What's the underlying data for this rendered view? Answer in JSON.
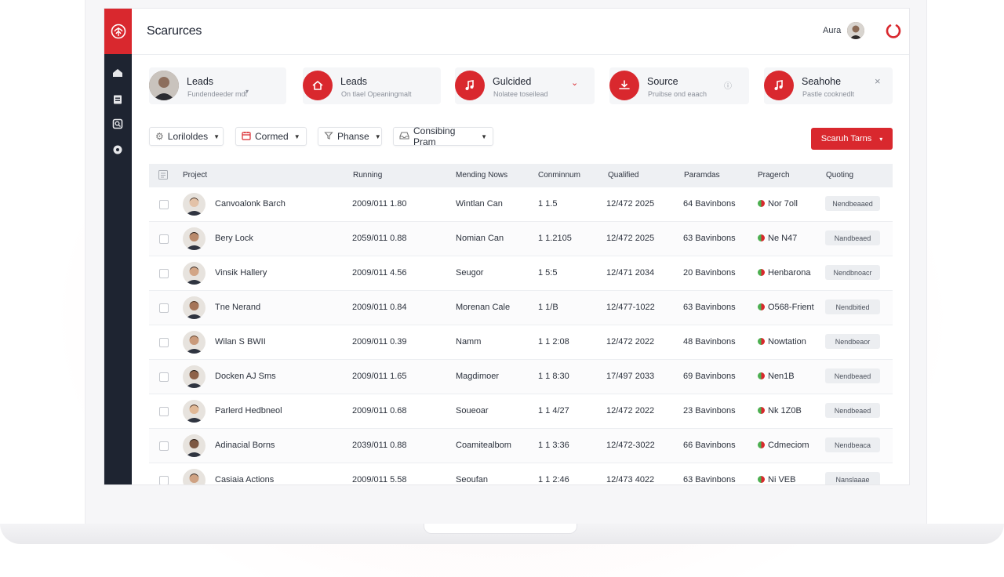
{
  "app": {
    "title": "Scarurces"
  },
  "user": {
    "name": "Aura"
  },
  "cards": [
    {
      "title": "Leads",
      "subtitle": "Fundendeeder mdt",
      "icon": "user-avatar"
    },
    {
      "title": "Leads",
      "subtitle": "On tlael Opeaningmalt",
      "icon": "home-icon"
    },
    {
      "title": "Gulcided",
      "subtitle": "Nolatee toseilead",
      "icon": "music-note-icon"
    },
    {
      "title": "Source",
      "subtitle": "Pruibse ond eaach",
      "icon": "download-icon"
    },
    {
      "title": "Seahohe",
      "subtitle": "Pastle cooknedlt",
      "icon": "music-note-icon"
    }
  ],
  "filters": [
    {
      "label": "Loriloldes",
      "icon": "settings-icon"
    },
    {
      "label": "Cormed",
      "icon": "calendar-icon"
    },
    {
      "label": "Phanse",
      "icon": "filter-icon"
    },
    {
      "label": "Consibing Pram",
      "icon": "inbox-icon"
    }
  ],
  "search_button": {
    "label": "Scaruh Tarns"
  },
  "table": {
    "headers": [
      "Project",
      "Running",
      "Mending Nows",
      "Conminnum",
      "Qualified",
      "Paramdas",
      "Pragerch",
      "Quoting"
    ],
    "rows": [
      {
        "name": "Canvoalonk Barch",
        "running": "2009/011 1.80",
        "mending": "Wintlan Can",
        "conminnum": "1 1.5",
        "qualified": "12/472 2025",
        "paramdas": "64 Bavinbons",
        "pragerch": "Nor 7oll",
        "quoting": "Nendbeaaed"
      },
      {
        "name": "Bery Lock",
        "running": "2059/011 0.88",
        "mending": "Nomian Can",
        "conminnum": "1 1.2105",
        "qualified": "12/472 2025",
        "paramdas": "63 Bavinbons",
        "pragerch": "Ne N47",
        "quoting": "Nandbeaed"
      },
      {
        "name": "Vinsik Hallery",
        "running": "2009/011 4.56",
        "mending": "Seugor",
        "conminnum": "1 5:5",
        "qualified": "12/471 2034",
        "paramdas": "20 Bavinbons",
        "pragerch": "Henbarona",
        "quoting": "Nendbnoacr"
      },
      {
        "name": "Tne Nerand",
        "running": "2009/011 0.84",
        "mending": "Morenan Cale",
        "conminnum": "1 1/B",
        "qualified": "12/477-1022",
        "paramdas": "63 Bavinbons",
        "pragerch": "O568-Frient",
        "quoting": "Nendbitied"
      },
      {
        "name": "Wilan S BWII",
        "running": "2009/011 0.39",
        "mending": "Namm",
        "conminnum": "1 1 2:08",
        "qualified": "12/472 2022",
        "paramdas": "48 Bavinbons",
        "pragerch": "Nowtation",
        "quoting": "Nendbeaor"
      },
      {
        "name": "Docken AJ Sms",
        "running": "2009/011 1.65",
        "mending": "Magdimoer",
        "conminnum": "1 1 8:30",
        "qualified": "17/497 2033",
        "paramdas": "69 Bavinbons",
        "pragerch": "Nen1B",
        "quoting": "Nendbeaed"
      },
      {
        "name": "Parlerd Hedbneol",
        "running": "2009/011 0.68",
        "mending": "Soueoar",
        "conminnum": "1 1 4/27",
        "qualified": "12/472 2022",
        "paramdas": "23 Bavinbons",
        "pragerch": "Nk 1Z0B",
        "quoting": "Nendbeaed"
      },
      {
        "name": "Adinacial Borns",
        "running": "2039/011 0.88",
        "mending": "Coamitealbom",
        "conminnum": "1 1 3:36",
        "qualified": "12/472-3022",
        "paramdas": "66 Bavinbons",
        "pragerch": "Cdmeciom",
        "quoting": "Nendbeaca"
      },
      {
        "name": "Casiaia Actions",
        "running": "2009/011 5.58",
        "mending": "Seoufan",
        "conminnum": "1 1 2:46",
        "qualified": "12/473 4022",
        "paramdas": "63 Bavinbons",
        "pragerch": "Ni VEB",
        "quoting": "Nanslaaae"
      }
    ]
  },
  "colors": {
    "accent": "#d9282e",
    "sidebar": "#1e2431",
    "header_bg": "#eef0f3"
  }
}
